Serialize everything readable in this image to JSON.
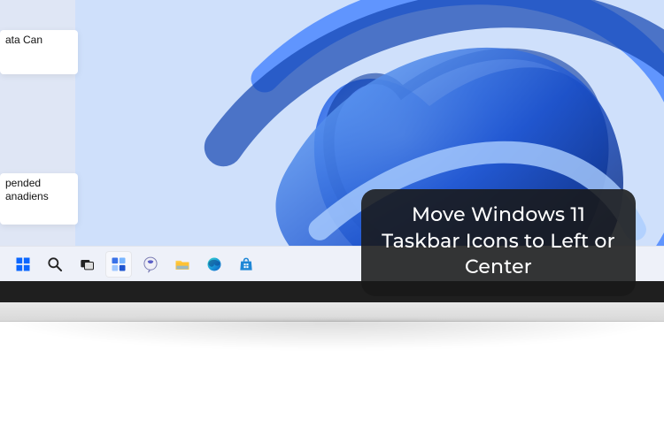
{
  "caption": "Move Windows 11 Taskbar Icons to Left or Center",
  "fragments": {
    "frag1_line1": "ata Can",
    "frag2_line1": "pended",
    "frag2_line2": "anadiens"
  },
  "taskbar": {
    "icons": [
      {
        "name": "start",
        "label": "Start"
      },
      {
        "name": "search",
        "label": "Search"
      },
      {
        "name": "task-view",
        "label": "Task View"
      },
      {
        "name": "widgets",
        "label": "Widgets"
      },
      {
        "name": "chat",
        "label": "Chat"
      },
      {
        "name": "file-explorer",
        "label": "File Explorer"
      },
      {
        "name": "edge",
        "label": "Microsoft Edge"
      },
      {
        "name": "store",
        "label": "Microsoft Store"
      }
    ]
  },
  "colors": {
    "accent": "#0a66ff",
    "bloom_light": "#78b5ff",
    "bloom_mid": "#2f6de0",
    "bloom_dark": "#0a2a78"
  }
}
